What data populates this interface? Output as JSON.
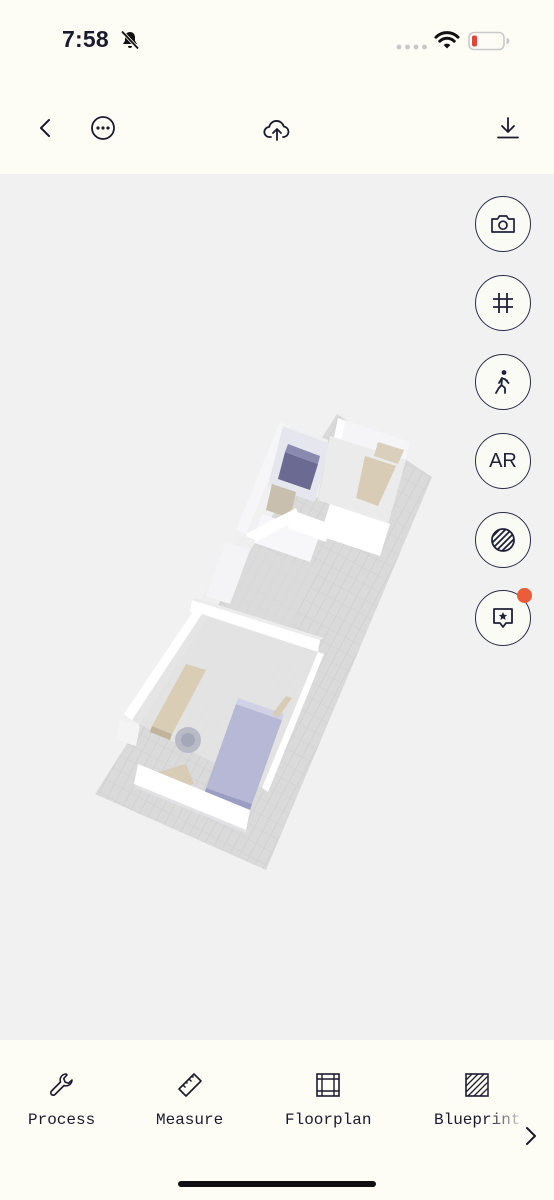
{
  "status_bar": {
    "time": "7:58",
    "icons": [
      "bell-slash-icon",
      "cellular-dots-icon",
      "wifi-icon",
      "battery-low-icon"
    ],
    "battery_color": "#e0453a"
  },
  "top_bar": {
    "buttons": [
      "chevron-left-icon",
      "more-icon",
      "cloud-upload-icon",
      "download-icon"
    ]
  },
  "viewport": {
    "background": "#f1f1f1",
    "side_tools": [
      {
        "name": "camera-icon"
      },
      {
        "name": "grid-icon"
      },
      {
        "name": "walk-icon"
      },
      {
        "name": "ar",
        "label": "AR"
      },
      {
        "name": "texture-icon"
      },
      {
        "name": "feedback-star-icon",
        "badge": true
      }
    ],
    "accent_badge": "#ee5b3a"
  },
  "bottom_tabs": {
    "items": [
      {
        "label": "Process",
        "icon": "wrench-icon"
      },
      {
        "label": "Measure",
        "icon": "ruler-icon"
      },
      {
        "label": "Floorplan",
        "icon": "floorplan-icon"
      },
      {
        "label": "Blueprint",
        "icon": "blueprint-icon"
      }
    ],
    "more_icon": "chevron-right-icon"
  }
}
